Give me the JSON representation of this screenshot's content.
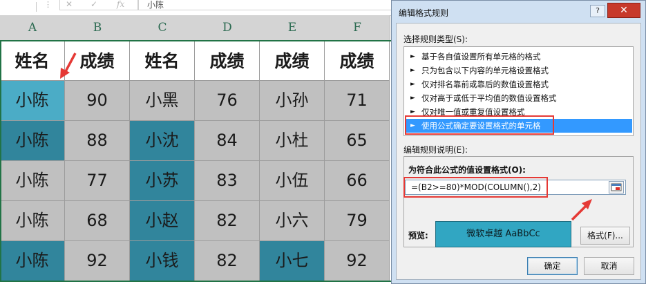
{
  "formula_bar": {
    "cell_content": "小陈"
  },
  "columns": [
    "A",
    "B",
    "C",
    "D",
    "E",
    "F"
  ],
  "rows": [
    [
      {
        "v": "姓名",
        "s": "hdr"
      },
      {
        "v": "成绩",
        "s": "hdr"
      },
      {
        "v": "姓名",
        "s": "hdr"
      },
      {
        "v": "成绩",
        "s": "hdr"
      },
      {
        "v": "成绩",
        "s": "hdr"
      },
      {
        "v": "成绩",
        "s": "hdr"
      }
    ],
    [
      {
        "v": "小陈",
        "s": "light"
      },
      {
        "v": "90",
        "s": "gray"
      },
      {
        "v": "小黑",
        "s": "gray"
      },
      {
        "v": "76",
        "s": "gray"
      },
      {
        "v": "小孙",
        "s": "gray"
      },
      {
        "v": "71",
        "s": "gray"
      }
    ],
    [
      {
        "v": "小陈",
        "s": "dark"
      },
      {
        "v": "88",
        "s": "gray"
      },
      {
        "v": "小沈",
        "s": "dark"
      },
      {
        "v": "84",
        "s": "gray"
      },
      {
        "v": "小杜",
        "s": "gray"
      },
      {
        "v": "65",
        "s": "gray"
      }
    ],
    [
      {
        "v": "小陈",
        "s": "gray"
      },
      {
        "v": "77",
        "s": "gray"
      },
      {
        "v": "小苏",
        "s": "dark"
      },
      {
        "v": "83",
        "s": "gray"
      },
      {
        "v": "小伍",
        "s": "gray"
      },
      {
        "v": "66",
        "s": "gray"
      }
    ],
    [
      {
        "v": "小陈",
        "s": "gray"
      },
      {
        "v": "68",
        "s": "gray"
      },
      {
        "v": "小赵",
        "s": "dark"
      },
      {
        "v": "82",
        "s": "gray"
      },
      {
        "v": "小六",
        "s": "gray"
      },
      {
        "v": "79",
        "s": "gray"
      }
    ],
    [
      {
        "v": "小陈",
        "s": "dark"
      },
      {
        "v": "92",
        "s": "gray"
      },
      {
        "v": "小钱",
        "s": "dark"
      },
      {
        "v": "82",
        "s": "gray"
      },
      {
        "v": "小七",
        "s": "dark"
      },
      {
        "v": "92",
        "s": "gray"
      }
    ]
  ],
  "dialog": {
    "title": "编辑格式规则",
    "help": "?",
    "close": "✕",
    "rule_type_label": "选择规则类型(S):",
    "rule_types": [
      "基于各自值设置所有单元格的格式",
      "只为包含以下内容的单元格设置格式",
      "仅对排名靠前或靠后的数值设置格式",
      "仅对高于或低于平均值的数值设置格式",
      "仅对唯一值或重复值设置格式",
      "使用公式确定要设置格式的单元格"
    ],
    "selected_rule_index": 5,
    "desc_label": "编辑规则说明(E):",
    "formula_label": "为符合此公式的值设置格式(O):",
    "formula": "=(B2>=80)*MOD(COLUMN(),2)",
    "preview_label": "预览:",
    "preview_text": "微软卓越  AaBbCc",
    "format_button": "格式(F)...",
    "ok_button": "确定",
    "cancel_button": "取消"
  },
  "colors": {
    "light_teal": "#4bacc6",
    "dark_teal": "#31859c",
    "gray_fill": "#c0c0c0",
    "annotation_red": "#e53935",
    "selection_blue": "#3399ff"
  }
}
